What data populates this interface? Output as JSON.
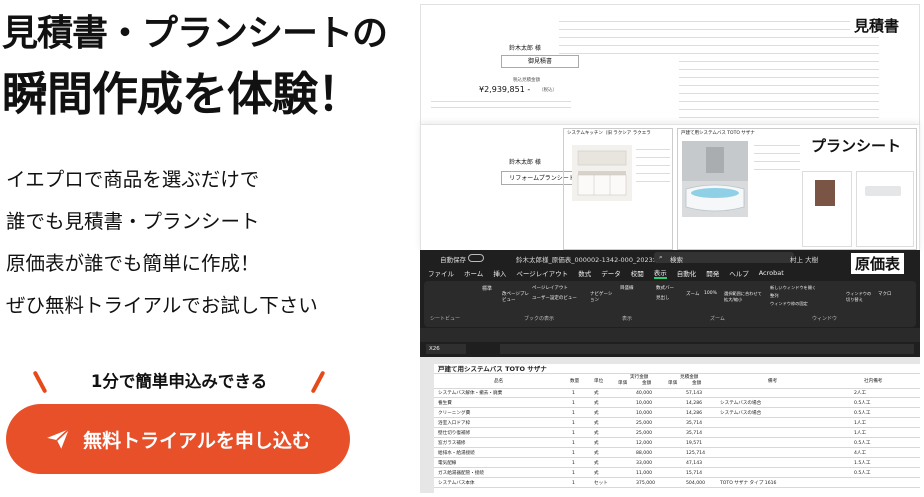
{
  "hero": {
    "title_line1": "見積書・プランシートの",
    "title_line2": "瞬間作成を体験！"
  },
  "description": {
    "lines": [
      "イエプロで商品を選ぶだけで",
      "誰でも見積書・プランシート",
      "原価表が誰でも簡単に作成！",
      "ぜひ無料トライアルでお試し下さい"
    ]
  },
  "cta": {
    "caption": "1分で簡単申込みできる",
    "button_label": "無料トライアルを申し込む",
    "button_color": "#e8502a",
    "icon": "paper-plane-icon"
  },
  "collage": {
    "estimate": {
      "tag": "見積書",
      "customer": "鈴木太郎 様",
      "doc_name": "御見積書",
      "amount_label": "税込見積金額",
      "amount": "¥2,939,851 -",
      "amount_note": "（税込）"
    },
    "plan": {
      "tag": "プランシート",
      "customer": "鈴木太郎 様",
      "doc_name": "リフォームプランシート",
      "kitchen_title": "システムキッチン（旧 ラクシア ラクエラ",
      "bath_title": "戸建て用システムバス TOTO サザナ"
    },
    "cost_sheet": {
      "tag": "原価表",
      "autosave": "自動保存",
      "filename": "鈴木太郎様_原価表_000002-1342-000_2023年3月6日.xlsx",
      "search": "検索",
      "user": "村上 大樹",
      "menu": [
        "ファイル",
        "ホーム",
        "挿入",
        "ページレイアウト",
        "数式",
        "データ",
        "校閲",
        "表示",
        "自動化",
        "開発",
        "ヘルプ",
        "Acrobat"
      ],
      "active_menu": "表示",
      "ribbon_groups": [
        "シートビュー",
        "ブックの表示",
        "表示",
        "ズーム",
        "ウィンドウ"
      ],
      "ribbon_items": [
        "標準",
        "改ページプレビュー",
        "ページレイアウト",
        "ユーザー設定のビュー",
        "ナビゲーション",
        "目盛線",
        "数式バー",
        "見出し",
        "ズーム",
        "100%",
        "選択範囲に合わせて拡大/縮小",
        "新しいウィンドウを開く",
        "整列",
        "ウィンドウ枠の固定",
        "ウィンドウの切り替え",
        "マクロ"
      ],
      "cell_ref": "X26",
      "sheet_title": "戸建て用システムバス TOTO サザナ",
      "headers": [
        "品名",
        "数量",
        "単位",
        "実行金額",
        "見積金額",
        "備考",
        "社内備考"
      ],
      "subheaders": [
        "単価",
        "金額",
        "単価",
        "金額"
      ],
      "rows": [
        {
          "name": "システムバス解体・撤去・廃棄",
          "qty": "1",
          "unit": "式",
          "c_amt": "40,000",
          "e_amt": "57,143",
          "note": "",
          "inner": "2人工"
        },
        {
          "name": "養生費",
          "qty": "1",
          "unit": "式",
          "c_amt": "10,000",
          "e_amt": "14,286",
          "note": "システムバスの場合",
          "inner": "0.5人工"
        },
        {
          "name": "クリーニング費",
          "qty": "1",
          "unit": "式",
          "c_amt": "10,000",
          "e_amt": "14,286",
          "note": "システムバスの場合",
          "inner": "0.5人工"
        },
        {
          "name": "浴室入口ドア枠",
          "qty": "1",
          "unit": "式",
          "c_amt": "25,000",
          "e_amt": "35,714",
          "note": "",
          "inner": "1人工"
        },
        {
          "name": "壁仕切り復補修",
          "qty": "1",
          "unit": "式",
          "c_amt": "25,000",
          "e_amt": "35,714",
          "note": "",
          "inner": "1人工"
        },
        {
          "name": "窓ガラス補修",
          "qty": "1",
          "unit": "式",
          "c_amt": "12,000",
          "e_amt": "19,571",
          "note": "",
          "inner": "0.5人工"
        },
        {
          "name": "給排水・給湯接続",
          "qty": "1",
          "unit": "式",
          "c_amt": "88,000",
          "e_amt": "125,714",
          "note": "",
          "inner": "4人工"
        },
        {
          "name": "電気配線",
          "qty": "1",
          "unit": "式",
          "c_amt": "33,000",
          "e_amt": "47,143",
          "note": "",
          "inner": "1.5人工"
        },
        {
          "name": "ガス給湯器配管・接続",
          "qty": "1",
          "unit": "式",
          "c_amt": "11,000",
          "e_amt": "15,714",
          "note": "",
          "inner": "0.5人工"
        },
        {
          "name": "システムバス本体",
          "qty": "1",
          "unit": "セット",
          "c_amt": "375,000",
          "e_amt": "504,000",
          "note": "TOTO サザナ タイプ 1616",
          "inner": ""
        }
      ]
    }
  }
}
